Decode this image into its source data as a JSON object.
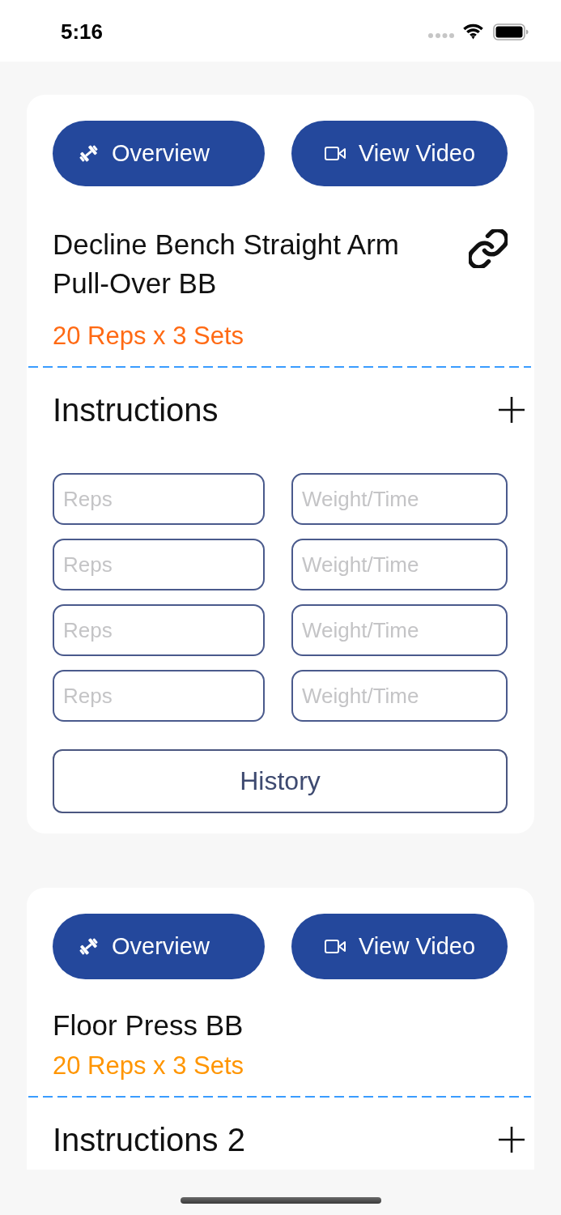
{
  "status_bar": {
    "time": "5:16"
  },
  "exercises": [
    {
      "buttons": [
        {
          "kind": "overview",
          "label": "Overview"
        },
        {
          "kind": "video",
          "label": "View Video"
        }
      ],
      "title": "Decline Bench Straight Arm Pull-Over BB",
      "linked": true,
      "scheme": "20 Reps x 3 Sets",
      "color": "#ff6a14",
      "instructions": {
        "title": "Instructions",
        "sets": [
          {
            "reps": {
              "placeholder": "Reps"
            },
            "weight": {
              "placeholder": "Weight/Time"
            }
          },
          {
            "reps": {
              "placeholder": "Reps"
            },
            "weight": {
              "placeholder": "Weight/Time"
            }
          },
          {
            "reps": {
              "placeholder": "Reps"
            },
            "weight": {
              "placeholder": "Weight/Time"
            }
          },
          {
            "reps": {
              "placeholder": "Reps"
            },
            "weight": {
              "placeholder": "Weight/Time"
            }
          }
        ],
        "history": "History"
      }
    },
    {
      "buttons": [
        {
          "kind": "overview",
          "label": "Overview"
        },
        {
          "kind": "video",
          "label": "View Video"
        }
      ],
      "title": "Floor Press BB",
      "linked": false,
      "scheme": "20 Reps x 3 Sets",
      "color": "#ff9500",
      "instructions": {
        "title": "Instructions 2"
      }
    }
  ]
}
